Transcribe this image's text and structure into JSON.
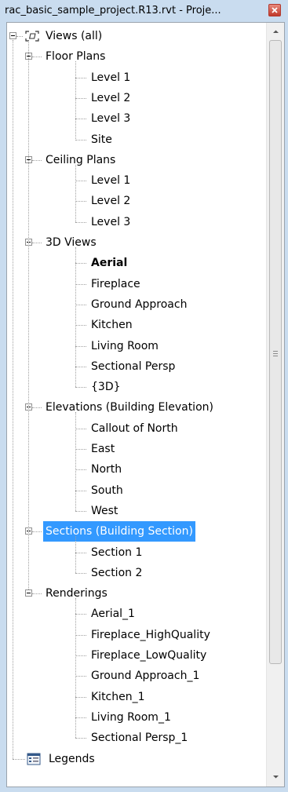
{
  "window": {
    "title": "rac_basic_sample_project.R13.rvt - Proje..."
  },
  "colors": {
    "selection": "#3399ff",
    "titlebar": "#c9dcef"
  },
  "tree": {
    "root": {
      "label": "Views (all)",
      "icon": "views-icon"
    },
    "groups": [
      {
        "key": "floor-plans",
        "label": "Floor Plans",
        "items": [
          "Level 1",
          "Level 2",
          "Level 3",
          "Site"
        ]
      },
      {
        "key": "ceiling-plans",
        "label": "Ceiling Plans",
        "items": [
          "Level 1",
          "Level 2",
          "Level 3"
        ]
      },
      {
        "key": "3d-views",
        "label": "3D Views",
        "items": [
          "Aerial",
          "Fireplace",
          "Ground Approach",
          "Kitchen",
          "Living Room",
          "Sectional Persp",
          "{3D}"
        ],
        "bold_item": "Aerial"
      },
      {
        "key": "elevations",
        "label": "Elevations (Building Elevation)",
        "items": [
          "Callout of North",
          "East",
          "North",
          "South",
          "West"
        ]
      },
      {
        "key": "sections",
        "label": "Sections (Building Section)",
        "items": [
          "Section 1",
          "Section 2"
        ],
        "selected": true
      },
      {
        "key": "renderings",
        "label": "Renderings",
        "items": [
          "Aerial_1",
          "Fireplace_HighQuality",
          "Fireplace_LowQuality",
          "Ground Approach_1",
          "Kitchen_1",
          "Living Room_1",
          "Sectional Persp_1"
        ]
      }
    ],
    "legends": {
      "label": "Legends",
      "icon": "legends-icon"
    }
  }
}
